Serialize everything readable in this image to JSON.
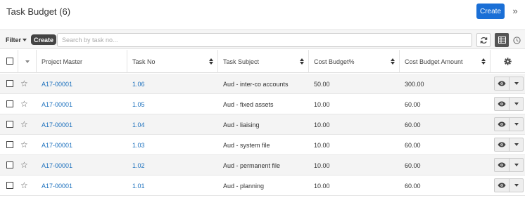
{
  "header": {
    "title": "Task Budget (6)",
    "create_label": "Create",
    "collapse_glyph": "»"
  },
  "toolbar": {
    "filter_label": "Filter",
    "create_label": "Create",
    "search_placeholder": "Search by task no...",
    "icons": [
      "refresh-icon",
      "grid-view-icon",
      "clock-icon"
    ]
  },
  "table": {
    "columns": [
      "Project Master",
      "Task No",
      "Task Subject",
      "Cost Budget%",
      "Cost Budget Amount"
    ],
    "rows": [
      {
        "project": "A17-00001",
        "task_no": "1.06",
        "subject": "Aud - inter-co accounts",
        "budget_pct": "50.00",
        "amount": "300.00"
      },
      {
        "project": "A17-00001",
        "task_no": "1.05",
        "subject": "Aud - fixed assets",
        "budget_pct": "10.00",
        "amount": "60.00"
      },
      {
        "project": "A17-00001",
        "task_no": "1.04",
        "subject": "Aud - liaising",
        "budget_pct": "10.00",
        "amount": "60.00"
      },
      {
        "project": "A17-00001",
        "task_no": "1.03",
        "subject": "Aud - system file",
        "budget_pct": "10.00",
        "amount": "60.00"
      },
      {
        "project": "A17-00001",
        "task_no": "1.02",
        "subject": "Aud - permanent file",
        "budget_pct": "10.00",
        "amount": "60.00"
      },
      {
        "project": "A17-00001",
        "task_no": "1.01",
        "subject": "Aud - planning",
        "budget_pct": "10.00",
        "amount": "60.00"
      }
    ]
  },
  "colors": {
    "primary": "#1a6fd6",
    "link": "#1a6fbd"
  }
}
